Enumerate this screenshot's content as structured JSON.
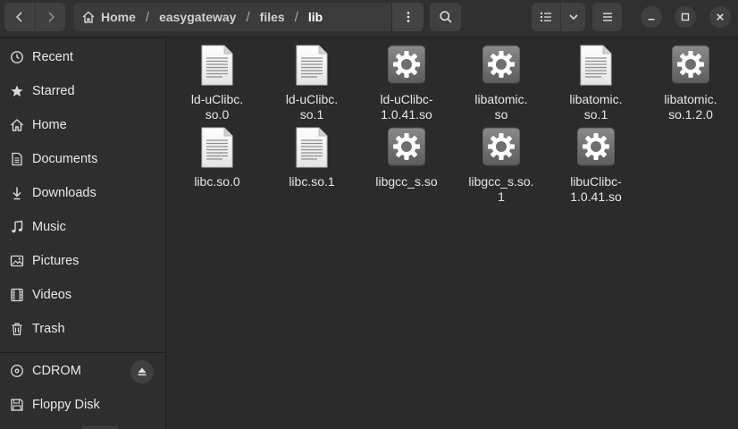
{
  "header": {
    "path": [
      {
        "label": "Home",
        "icon": "home-icon"
      },
      {
        "label": "easygateway"
      },
      {
        "label": "files"
      },
      {
        "label": "lib",
        "current": true
      }
    ]
  },
  "sidebar": {
    "items": [
      {
        "label": "Recent",
        "icon": "clock-icon"
      },
      {
        "label": "Starred",
        "icon": "star-icon"
      },
      {
        "label": "Home",
        "icon": "home-icon"
      },
      {
        "label": "Documents",
        "icon": "document-icon"
      },
      {
        "label": "Downloads",
        "icon": "download-icon"
      },
      {
        "label": "Music",
        "icon": "music-icon"
      },
      {
        "label": "Pictures",
        "icon": "picture-icon"
      },
      {
        "label": "Videos",
        "icon": "video-icon"
      },
      {
        "label": "Trash",
        "icon": "trash-icon"
      }
    ],
    "devices": [
      {
        "label": "CDROM",
        "icon": "disc-icon"
      },
      {
        "label": "Floppy Disk",
        "icon": "floppy-icon"
      }
    ]
  },
  "files": [
    {
      "lines": [
        "ld-uClibc.",
        "so.0"
      ],
      "icon": "text-file-icon"
    },
    {
      "lines": [
        "ld-uClibc.",
        "so.1"
      ],
      "icon": "text-file-icon"
    },
    {
      "lines": [
        "ld-uClibc-",
        "1.0.41.so"
      ],
      "icon": "gear-file-icon"
    },
    {
      "lines": [
        "libatomic.",
        "so"
      ],
      "icon": "gear-file-icon"
    },
    {
      "lines": [
        "libatomic.",
        "so.1"
      ],
      "icon": "text-file-icon"
    },
    {
      "lines": [
        "libatomic.",
        "so.1.2.0"
      ],
      "icon": "gear-file-icon"
    },
    {
      "lines": [
        "libc.so.0"
      ],
      "icon": "text-file-icon"
    },
    {
      "lines": [
        "libc.so.1"
      ],
      "icon": "text-file-icon"
    },
    {
      "lines": [
        "libgcc_s.so"
      ],
      "icon": "gear-file-icon"
    },
    {
      "lines": [
        "libgcc_s.so.",
        "1"
      ],
      "icon": "gear-file-icon"
    },
    {
      "lines": [
        "libuClibc-",
        "1.0.41.so"
      ],
      "icon": "gear-file-icon"
    }
  ],
  "colors": {
    "background": "#2b2b2b",
    "sidebar": "#2e2e2e",
    "headerbar": "#303030",
    "text": "#e8e8e8"
  }
}
